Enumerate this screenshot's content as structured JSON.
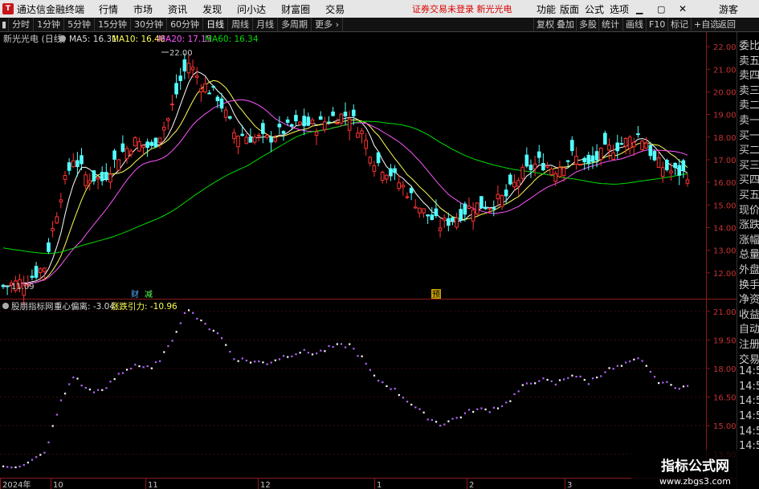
{
  "titlebar": {
    "app_name": "通达信金融终端",
    "menus": [
      "行情",
      "市场",
      "资讯",
      "发现",
      "问小达",
      "财富圈",
      "交易"
    ],
    "warning": "证券交易未登录  新光光电",
    "right_menus": [
      "功能",
      "版面",
      "公式",
      "选项"
    ],
    "guest": "游客"
  },
  "toolbar": {
    "periods": [
      "分时",
      "1分钟",
      "5分钟",
      "15分钟",
      "30分钟",
      "60分钟",
      "日线",
      "周线",
      "月线",
      "多周期",
      "更多"
    ],
    "active_period": "日线",
    "right_buttons": [
      "复权",
      "叠加",
      "多股",
      "统计",
      "画线",
      "F10",
      "标记",
      "+自选",
      "返回"
    ]
  },
  "main_chart": {
    "stock_title": "新光光电 (日线)",
    "ma5": "MA5: 16.31",
    "ma10": "MA10: 16.46",
    "ma20": "MA20: 17.15",
    "ma60": "MA60: 16.34",
    "high_label": "22.00",
    "low_label": "11.09",
    "markers": [
      "财",
      "减",
      "预"
    ]
  },
  "indicator": {
    "name": "股朋指标网",
    "center_deviation": "重心偏离: -3.04",
    "rise_fall_gravity": "涨跌引力: -10.96"
  },
  "chart_data": {
    "type": "candlestick",
    "price_axis": [
      22.0,
      21.0,
      20.0,
      19.0,
      18.0,
      17.0,
      16.0,
      15.0,
      14.0,
      13.0,
      12.0
    ],
    "ylim": [
      11.0,
      22.5
    ],
    "indicator_axis": [
      21.0,
      19.5,
      18.0,
      16.5,
      15.0,
      13.5
    ],
    "indicator_ylim": [
      12.3,
      21.5
    ],
    "x_labels": [
      "2024年",
      "10",
      "11",
      "12",
      "1",
      "2",
      "3"
    ],
    "ma_colors": {
      "ma5": "#ffffff",
      "ma10": "#ffff55",
      "ma20": "#ff55ff",
      "ma60": "#00dd00"
    },
    "up_color": "#ff3232",
    "down_color": "#54ffff"
  },
  "sidebar": {
    "items": [
      "委比",
      "卖五",
      "卖四",
      "卖三",
      "卖二",
      "卖一",
      "买一",
      "买二",
      "买三",
      "买四",
      "买五",
      "现价",
      "涨跌",
      "涨幅",
      "总量",
      "外盘",
      "换手",
      "净资",
      "收益",
      "自动",
      "注册",
      "交易",
      "14:5",
      "14:5",
      "14:5",
      "14:5",
      "14:5",
      "14:5"
    ]
  },
  "watermark": {
    "title": "指标公式网",
    "url": "www.zbgs3.com"
  }
}
